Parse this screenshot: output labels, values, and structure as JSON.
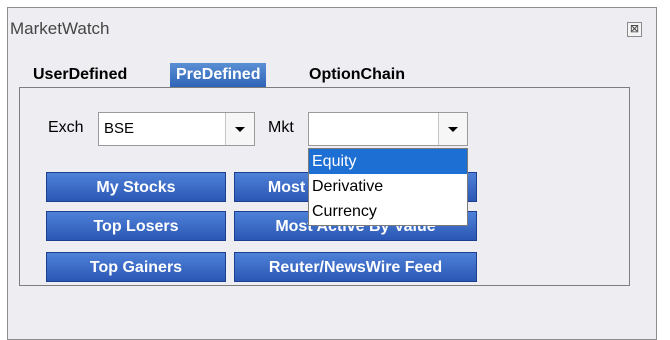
{
  "window": {
    "title": "MarketWatch",
    "close_label": "⊠"
  },
  "tabs": [
    {
      "label": "UserDefined"
    },
    {
      "label": "PreDefined"
    },
    {
      "label": "OptionChain"
    }
  ],
  "filters": {
    "exch_label": "Exch",
    "exch_value": "BSE",
    "mkt_label": "Mkt",
    "mkt_value": ""
  },
  "buttons": {
    "my_stocks": "My Stocks",
    "most_active_volume": "Most Active By Volume",
    "top_losers": "Top Losers",
    "most_active_value": "Most Active By Value",
    "top_gainers": "Top Gainers",
    "reuter_newswire": "Reuter/NewsWire Feed"
  },
  "mkt_options": [
    "Equity",
    "Derivative",
    "Currency"
  ]
}
